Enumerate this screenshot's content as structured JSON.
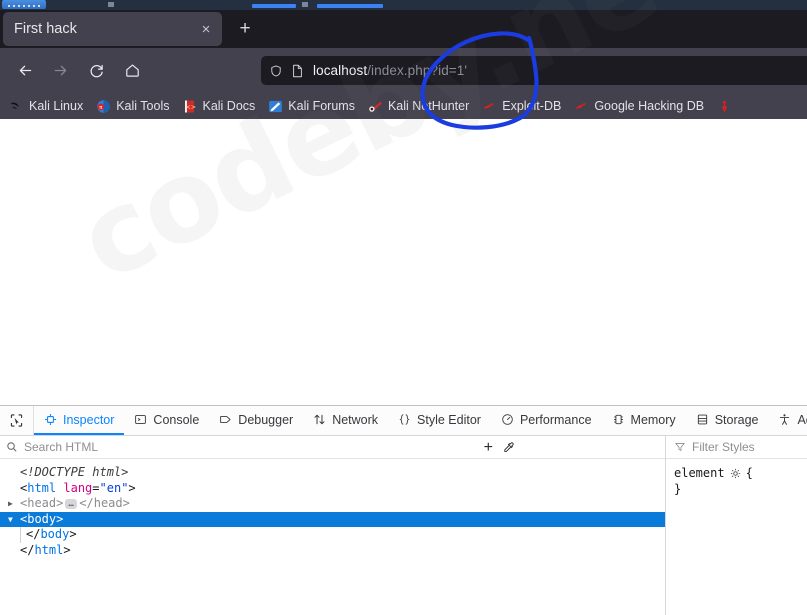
{
  "browser": {
    "tab": {
      "title": "First hack",
      "close_label": "×"
    },
    "new_tab_label": "+",
    "nav": {
      "back": "back-arrow",
      "forward": "forward-arrow",
      "reload": "reload",
      "home": "home"
    },
    "url": {
      "host": "localhost",
      "path": "/index.php?id=1'",
      "full": "localhost/index.php?id=1'"
    },
    "bookmarks": [
      {
        "label": "Kali Linux",
        "icon": "kali-dragon-icon"
      },
      {
        "label": "Kali Tools",
        "icon": "kali-tools-icon"
      },
      {
        "label": "Kali Docs",
        "icon": "kali-docs-icon"
      },
      {
        "label": "Kali Forums",
        "icon": "kali-forums-icon"
      },
      {
        "label": "Kali NetHunter",
        "icon": "kali-nethunter-icon"
      },
      {
        "label": "Exploit-DB",
        "icon": "exploit-db-icon"
      },
      {
        "label": "Google Hacking DB",
        "icon": "google-hacking-db-icon"
      },
      {
        "label": "",
        "icon": "offsec-icon"
      }
    ]
  },
  "watermark": {
    "text": "codeby.net"
  },
  "devtools": {
    "tabs": [
      {
        "label": "Inspector",
        "icon": "inspector-icon",
        "active": true
      },
      {
        "label": "Console",
        "icon": "console-icon",
        "active": false
      },
      {
        "label": "Debugger",
        "icon": "debugger-icon",
        "active": false
      },
      {
        "label": "Network",
        "icon": "network-icon",
        "active": false
      },
      {
        "label": "Style Editor",
        "icon": "style-editor-icon",
        "active": false
      },
      {
        "label": "Performance",
        "icon": "performance-icon",
        "active": false
      },
      {
        "label": "Memory",
        "icon": "memory-icon",
        "active": false
      },
      {
        "label": "Storage",
        "icon": "storage-icon",
        "active": false
      },
      {
        "label": "Acces",
        "icon": "accessibility-icon",
        "active": false
      }
    ],
    "search": {
      "placeholder": "Search HTML"
    },
    "markup": {
      "doctype": "<!DOCTYPE html>",
      "html_open_lt": "<",
      "html_tag": "html",
      "html_attr_name": "lang",
      "html_attr_eq": "=",
      "html_attr_value": "\"en\"",
      "html_open_gt": ">",
      "head_open": "<head>",
      "head_ellipsis": "…",
      "head_close": "</head>",
      "body_open": "<body>",
      "body_close_lt": "</",
      "body_close_tag": "body",
      "body_close_gt": ">",
      "html_close_lt": "</",
      "html_close_tag": "html",
      "html_close_gt": ">"
    },
    "styles": {
      "filter_placeholder": "Filter Styles",
      "rule_selector": "element",
      "rule_open": "{",
      "rule_close": "}"
    },
    "add_rule_label": "+",
    "eyedropper_label": "eyedropper"
  },
  "annotation": {
    "shape": "blue-hand-drawn-circle",
    "color": "#1a3ce0"
  },
  "colors": {
    "chrome_bg": "#42414d",
    "tabstrip_bg": "#1c1b22",
    "accent_blue": "#0a84ff",
    "selection_blue": "#0a7bd8",
    "page_bg": "#ffffff"
  }
}
